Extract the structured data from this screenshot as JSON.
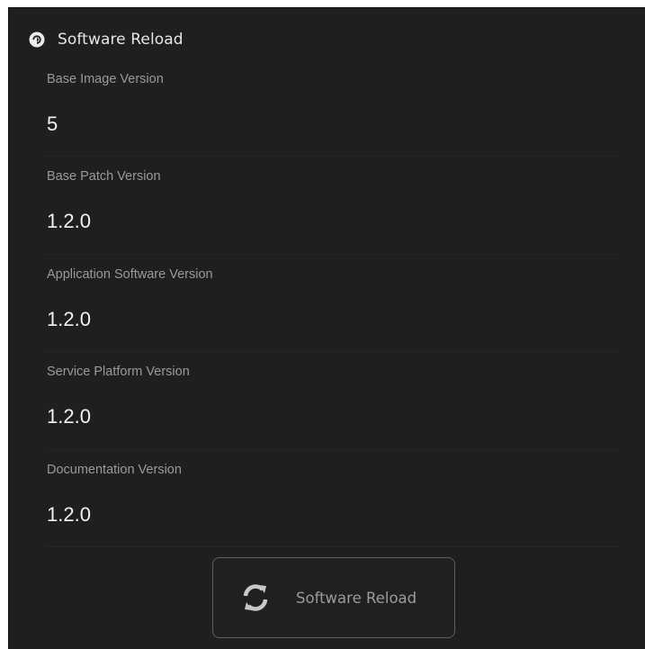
{
  "header": {
    "title": "Software Reload",
    "icon": "reload-circle-icon"
  },
  "fields": [
    {
      "label": "Base Image Version",
      "value": "5"
    },
    {
      "label": "Base Patch Version",
      "value": "1.2.0"
    },
    {
      "label": "Application Software Version",
      "value": "1.2.0"
    },
    {
      "label": "Service Platform Version",
      "value": "1.2.0"
    },
    {
      "label": "Documentation Version",
      "value": "1.2.0"
    }
  ],
  "button": {
    "label": "Software Reload",
    "icon": "refresh-icon"
  },
  "colors": {
    "background": "#1f1f1f",
    "label": "#9a9a9a",
    "value": "#f2f2f2",
    "button_border": "#5e5e5e",
    "button_text": "#9b9b9b"
  }
}
